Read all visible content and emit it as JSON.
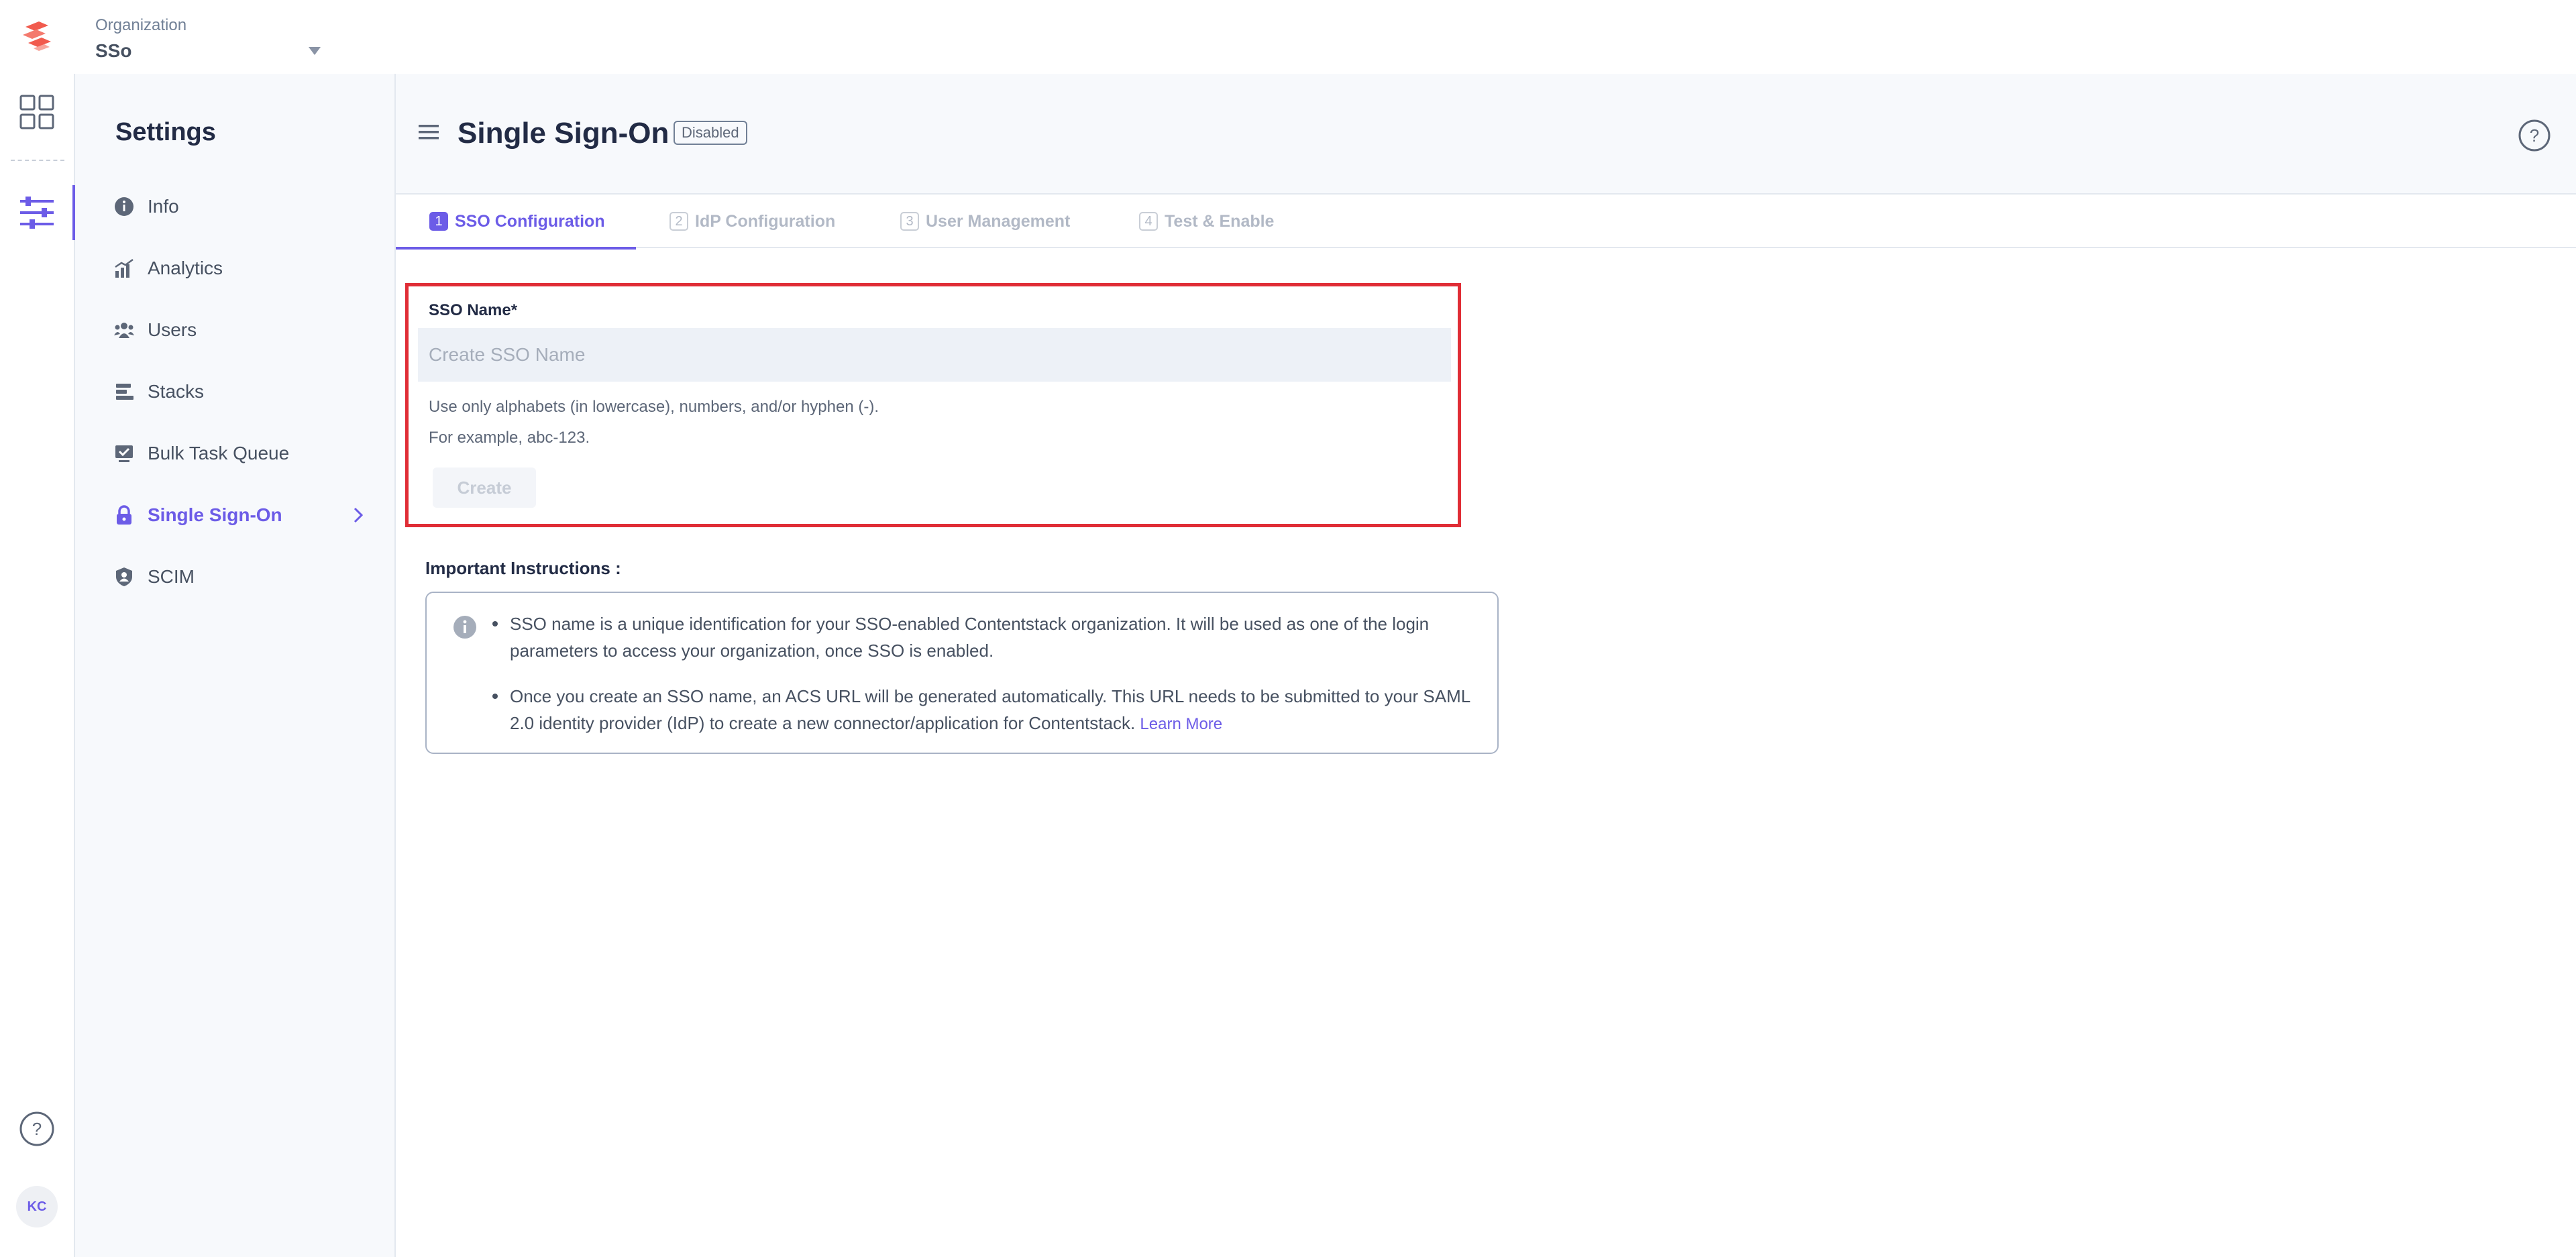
{
  "topbar": {
    "logo_icon": "contentstack-logo-icon",
    "org_label": "Organization",
    "org_name": "SSo",
    "org_dropdown_icon": "caret-down-icon"
  },
  "rail": {
    "items": [
      {
        "name": "apps-grid-icon"
      },
      {
        "name": "settings-sliders-icon",
        "active": true
      }
    ],
    "help_icon": "help-circle-icon",
    "avatar_initials": "KC"
  },
  "sidebar": {
    "title": "Settings",
    "items": [
      {
        "label": "Info",
        "icon": "info-icon"
      },
      {
        "label": "Analytics",
        "icon": "analytics-icon"
      },
      {
        "label": "Users",
        "icon": "users-icon"
      },
      {
        "label": "Stacks",
        "icon": "stacks-icon"
      },
      {
        "label": "Bulk Task Queue",
        "icon": "bulk-task-icon"
      },
      {
        "label": "Single Sign-On",
        "icon": "lock-icon",
        "active": true
      },
      {
        "label": "SCIM",
        "icon": "shield-user-icon"
      }
    ]
  },
  "header": {
    "title": "Single Sign-On",
    "status": "Disabled",
    "help_icon": "help-circle-icon"
  },
  "tabs": [
    {
      "num": "1",
      "label": "SSO Configuration",
      "active": true
    },
    {
      "num": "2",
      "label": "IdP Configuration",
      "active": false
    },
    {
      "num": "3",
      "label": "User Management",
      "active": false
    },
    {
      "num": "4",
      "label": "Test & Enable",
      "active": false
    }
  ],
  "form": {
    "field_label": "SSO Name*",
    "value": "",
    "placeholder": "Create SSO Name",
    "hint_line1": "Use only alphabets (in lowercase), numbers, and/or hyphen (-).",
    "hint_line2": "For example, abc-123.",
    "create_label": "Create"
  },
  "instructions": {
    "title": "Important Instructions :",
    "items": [
      "SSO name is a unique identification for your SSO-enabled Contentstack organization. It will be used as one of the login parameters to access your organization, once SSO is enabled.",
      "Once you create an SSO name, an ACS URL will be generated automatically. This URL needs to be submitted to your SAML 2.0 identity provider (IdP) to create a new connector/application for Contentstack."
    ],
    "learn_more": "Learn More"
  },
  "colors": {
    "accent": "#6c5ce7",
    "highlight": "#e02d36",
    "logo": "#f15b4e"
  }
}
